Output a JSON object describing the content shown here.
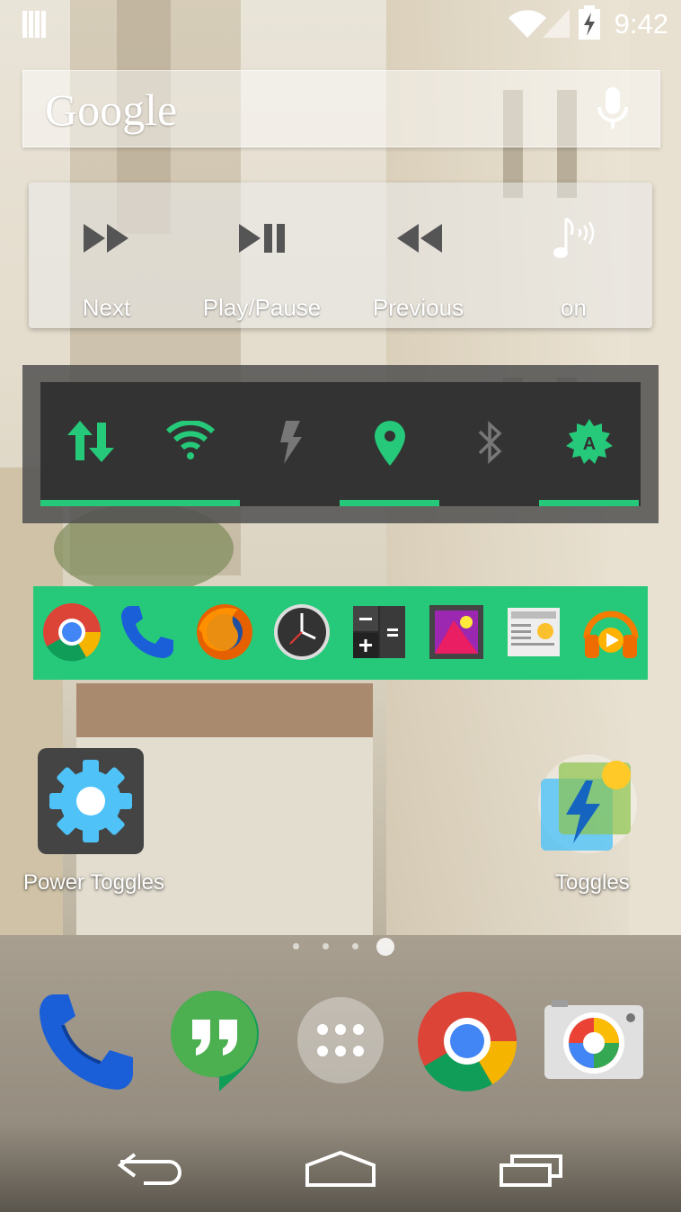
{
  "status_bar": {
    "time": "9:42"
  },
  "search": {
    "logo": "Google"
  },
  "music_widget": {
    "buttons": [
      {
        "label": "Next",
        "icon": "fast-forward-icon"
      },
      {
        "label": "Play/Pause",
        "icon": "play-pause-icon"
      },
      {
        "label": "Previous",
        "icon": "rewind-icon"
      },
      {
        "label": "on",
        "icon": "music-note-signal-icon"
      }
    ]
  },
  "toggles_widget": {
    "accent": "#26c979",
    "items": [
      {
        "icon": "mobile-data-icon",
        "on": true
      },
      {
        "icon": "wifi-icon",
        "on": true
      },
      {
        "icon": "flash-icon",
        "on": false
      },
      {
        "icon": "location-icon",
        "on": true
      },
      {
        "icon": "bluetooth-icon",
        "on": false
      },
      {
        "icon": "auto-brightness-icon",
        "on": true
      }
    ]
  },
  "app_bar": {
    "background": "#26c979",
    "apps": [
      "chrome-icon",
      "phone-icon",
      "firefox-icon",
      "clock-icon",
      "calculator-icon",
      "gallery-icon",
      "google-news-icon",
      "play-music-icon"
    ]
  },
  "home": {
    "shortcuts": [
      {
        "label": "Power Toggles",
        "icon": "settings-gear-icon"
      },
      {
        "label": "Toggles",
        "icon": "toggles-app-icon"
      }
    ],
    "page_indicator": {
      "pages": 4,
      "current": 4
    }
  },
  "dock": {
    "apps": [
      "phone-icon",
      "hangouts-icon",
      "app-drawer-icon",
      "chrome-icon",
      "camera-icon"
    ]
  },
  "nav_bar": {
    "buttons": [
      "back-icon",
      "home-icon",
      "recents-icon"
    ]
  }
}
